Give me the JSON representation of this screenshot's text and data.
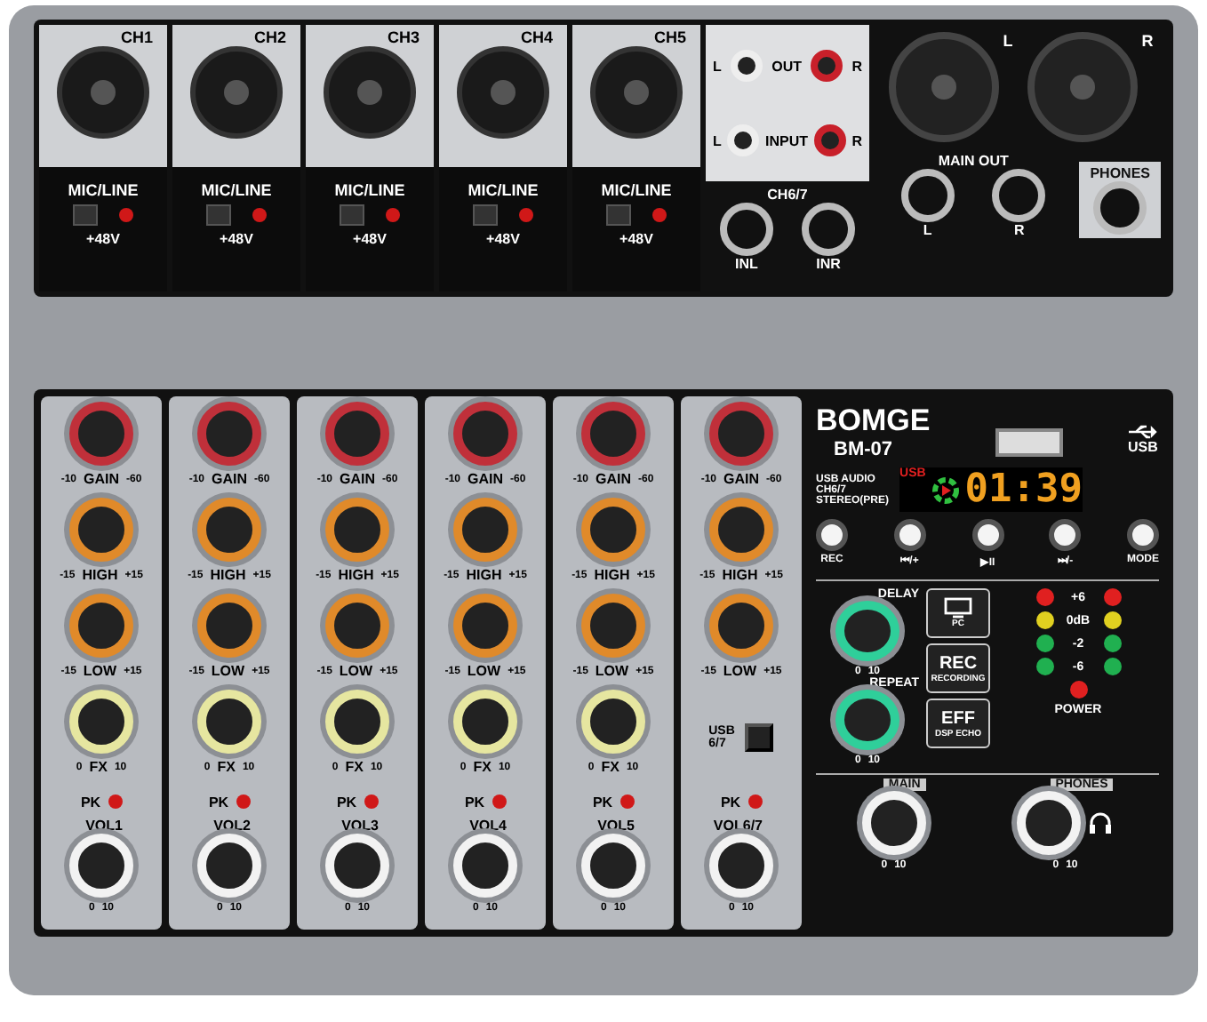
{
  "rear_inputs": [
    {
      "label": "CH1",
      "switch_label": "MIC/LINE",
      "switch_on": false,
      "phantom_label": "+48V"
    },
    {
      "label": "CH2",
      "switch_label": "MIC/LINE",
      "switch_on": false,
      "phantom_label": "+48V"
    },
    {
      "label": "CH3",
      "switch_label": "MIC/LINE",
      "switch_on": false,
      "phantom_label": "+48V"
    },
    {
      "label": "CH4",
      "switch_label": "MIC/LINE",
      "switch_on": false,
      "phantom_label": "+48V"
    },
    {
      "label": "CH5",
      "switch_label": "MIC/LINE",
      "switch_on": false,
      "phantom_label": "+48V"
    }
  ],
  "rca": {
    "out_row": [
      "L",
      "OUT",
      "R"
    ],
    "input_row": [
      "L",
      "INPUT",
      "R"
    ]
  },
  "ch67_inputs": {
    "label": "CH6/7",
    "jacks": [
      "INL",
      "INR"
    ]
  },
  "main_out": {
    "xlr": [
      "L",
      "R"
    ],
    "label": "MAIN OUT",
    "jacks": [
      "L",
      "R"
    ]
  },
  "phones_out": {
    "label": "PHONES"
  },
  "strips": [
    {
      "knobs": [
        {
          "kind": "gain",
          "label": "GAIN",
          "min": "-10",
          "max": "-60"
        },
        {
          "kind": "eq",
          "label": "HIGH",
          "min": "-15",
          "max": "+15"
        },
        {
          "kind": "eq",
          "label": "LOW",
          "min": "-15",
          "max": "+15"
        },
        {
          "kind": "fx",
          "label": "FX",
          "min": "0",
          "max": "10"
        }
      ],
      "peak_label": "PK",
      "volume": {
        "label": "VOL1",
        "min": "0",
        "max": "10"
      }
    },
    {
      "knobs": [
        {
          "kind": "gain",
          "label": "GAIN",
          "min": "-10",
          "max": "-60"
        },
        {
          "kind": "eq",
          "label": "HIGH",
          "min": "-15",
          "max": "+15"
        },
        {
          "kind": "eq",
          "label": "LOW",
          "min": "-15",
          "max": "+15"
        },
        {
          "kind": "fx",
          "label": "FX",
          "min": "0",
          "max": "10"
        }
      ],
      "peak_label": "PK",
      "volume": {
        "label": "VOL2",
        "min": "0",
        "max": "10"
      }
    },
    {
      "knobs": [
        {
          "kind": "gain",
          "label": "GAIN",
          "min": "-10",
          "max": "-60"
        },
        {
          "kind": "eq",
          "label": "HIGH",
          "min": "-15",
          "max": "+15"
        },
        {
          "kind": "eq",
          "label": "LOW",
          "min": "-15",
          "max": "+15"
        },
        {
          "kind": "fx",
          "label": "FX",
          "min": "0",
          "max": "10"
        }
      ],
      "peak_label": "PK",
      "volume": {
        "label": "VOL3",
        "min": "0",
        "max": "10"
      }
    },
    {
      "knobs": [
        {
          "kind": "gain",
          "label": "GAIN",
          "min": "-10",
          "max": "-60"
        },
        {
          "kind": "eq",
          "label": "HIGH",
          "min": "-15",
          "max": "+15"
        },
        {
          "kind": "eq",
          "label": "LOW",
          "min": "-15",
          "max": "+15"
        },
        {
          "kind": "fx",
          "label": "FX",
          "min": "0",
          "max": "10"
        }
      ],
      "peak_label": "PK",
      "volume": {
        "label": "VOL4",
        "min": "0",
        "max": "10"
      }
    },
    {
      "knobs": [
        {
          "kind": "gain",
          "label": "GAIN",
          "min": "-10",
          "max": "-60"
        },
        {
          "kind": "eq",
          "label": "HIGH",
          "min": "-15",
          "max": "+15"
        },
        {
          "kind": "eq",
          "label": "LOW",
          "min": "-15",
          "max": "+15"
        },
        {
          "kind": "fx",
          "label": "FX",
          "min": "0",
          "max": "10"
        }
      ],
      "peak_label": "PK",
      "volume": {
        "label": "VOL5",
        "min": "0",
        "max": "10"
      }
    },
    {
      "knobs": [
        {
          "kind": "gain",
          "label": "GAIN",
          "min": "-10",
          "max": "-60"
        },
        {
          "kind": "eq",
          "label": "HIGH",
          "min": "-15",
          "max": "+15"
        },
        {
          "kind": "eq",
          "label": "LOW",
          "min": "-15",
          "max": "+15"
        }
      ],
      "source_switch": {
        "labels": [
          "USB",
          "6/7"
        ],
        "on": false
      },
      "peak_label": "PK",
      "volume": {
        "label": "VOL6/7",
        "min": "0",
        "max": "10"
      }
    }
  ],
  "brand": "BOMGE",
  "model": "BM-07",
  "usb_label": "USB",
  "usb_audio_note": [
    "USB AUDIO",
    "CH6/7",
    "STEREO(PRE)"
  ],
  "display": {
    "source": "USB",
    "time": "01:39"
  },
  "player_buttons": [
    "REC",
    "⏮/+",
    "▶II",
    "⏭/-",
    "MODE"
  ],
  "effects": [
    {
      "label": "DELAY",
      "min": "0",
      "max": "10"
    },
    {
      "label": "REPEAT",
      "min": "0",
      "max": "10"
    }
  ],
  "mode_buttons": [
    {
      "kind": "icon",
      "sub": "PC"
    },
    {
      "kind": "text",
      "label": "REC",
      "sub": "RECORDING"
    },
    {
      "kind": "text",
      "label": "EFF",
      "sub": "DSP ECHO"
    }
  ],
  "meter": [
    {
      "label": "+6",
      "color": "#e02020"
    },
    {
      "label": "0dB",
      "color": "#e0d020"
    },
    {
      "label": "-2",
      "color": "#20b050"
    },
    {
      "label": "-6",
      "color": "#20b050"
    }
  ],
  "power": {
    "label": "POWER",
    "color": "#e02020"
  },
  "main_knob": {
    "label": "MAIN",
    "min": "0",
    "max": "10"
  },
  "phones_knob": {
    "label": "PHONES",
    "min": "0",
    "max": "10"
  }
}
